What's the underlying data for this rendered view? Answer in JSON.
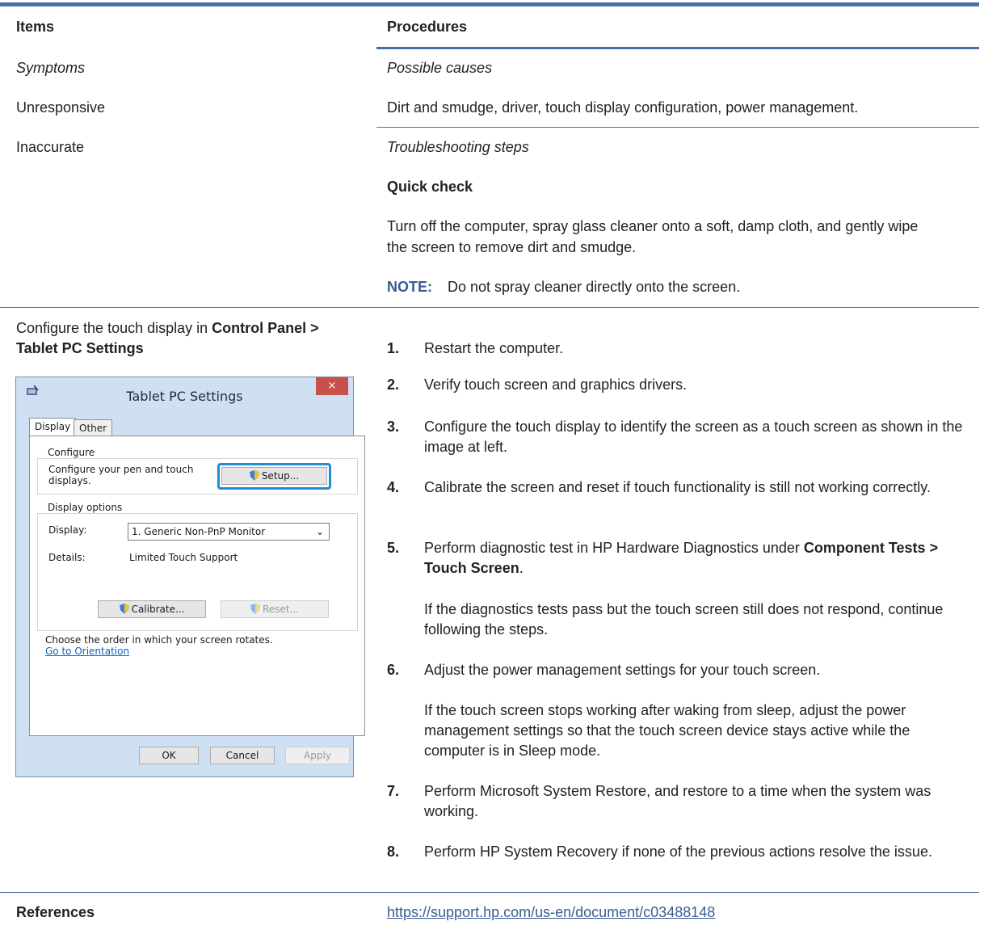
{
  "table": {
    "header": {
      "items": "Items",
      "procedures": "Procedures"
    },
    "row_symptoms": {
      "left": "Symptoms",
      "right": "Possible causes"
    },
    "row_unresponsive": {
      "left": "Unresponsive",
      "right": "Dirt and smudge, driver, touch display configuration, power management."
    },
    "row_inaccurate": {
      "left": "Inaccurate",
      "right": "Troubleshooting steps"
    },
    "quick_check": {
      "heading": "Quick check",
      "text_line1": "Turn off the computer, spray glass cleaner onto a soft, damp cloth, and gently wipe",
      "text_line2": "the screen to remove dirt and smudge.",
      "note_label": "NOTE:",
      "note_text": "Do not spray cleaner directly onto the screen."
    },
    "configure": {
      "text_prefix": "Configure the touch display in ",
      "text_bold1": "Control Panel >",
      "text_bold2": "Tablet PC Settings"
    },
    "steps": [
      {
        "num": "1.",
        "text": "Restart the computer."
      },
      {
        "num": "2.",
        "text": "Verify touch screen and graphics drivers."
      },
      {
        "num": "3.",
        "text": "Configure the touch display to identify the screen as a touch screen as shown in the image at left."
      },
      {
        "num": "4.",
        "text": "Calibrate the screen and reset if touch functionality is still not working correctly."
      },
      {
        "num": "5.",
        "text_prefix": "Perform diagnostic test in HP Hardware Diagnostics under ",
        "text_bold": "Component Tests > Touch Screen",
        "text_suffix": ".",
        "sub": "If the diagnostics tests pass but the touch screen still does not respond, continue following the steps."
      },
      {
        "num": "6.",
        "text": "Adjust the power management settings for your touch screen.",
        "sub": "If the touch screen stops working after waking from sleep, adjust the power management settings so that the touch screen device stays active while the computer is in Sleep mode."
      },
      {
        "num": "7.",
        "text": "Perform Microsoft System Restore, and restore to a time when the system was working."
      },
      {
        "num": "8.",
        "text": "Perform HP System Recovery if none of the previous actions resolve the issue."
      }
    ],
    "references": {
      "label": "References",
      "link": "https://support.hp.com/us-en/document/c03488148"
    }
  },
  "dialog": {
    "title": "Tablet PC Settings",
    "close": "×",
    "tabs": [
      "Display",
      "Other"
    ],
    "configure_group": "Configure",
    "configure_text_line1": "Configure your pen and touch",
    "configure_text_line2": "displays.",
    "setup_button": "Setup...",
    "display_options_group": "Display options",
    "display_label": "Display:",
    "display_value": "1. Generic Non-PnP Monitor",
    "details_label": "Details:",
    "details_value": "Limited Touch Support",
    "calibrate_button": "Calibrate...",
    "reset_button": "Reset...",
    "orientation_text": "Choose the order in which your screen rotates.",
    "orientation_link": "Go to Orientation",
    "ok_button": "OK",
    "cancel_button": "Cancel",
    "apply_button": "Apply"
  },
  "colors": {
    "accent": "#4a6fa5",
    "link": "#3a5d93",
    "dialog_bg": "#cfe0f2",
    "close_red": "#c7504a",
    "highlight": "#1f8ed1"
  }
}
